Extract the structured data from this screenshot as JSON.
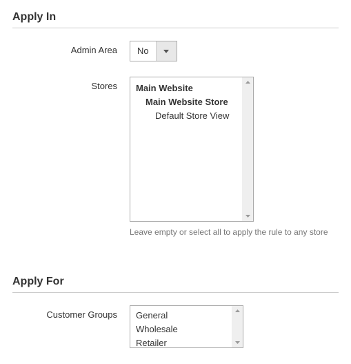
{
  "applyIn": {
    "title": "Apply In",
    "adminArea": {
      "label": "Admin Area",
      "value": "No"
    },
    "stores": {
      "label": "Stores",
      "items": [
        {
          "text": "Main Website",
          "bold": true,
          "indent": 0
        },
        {
          "text": "Main Website Store",
          "bold": true,
          "indent": 1
        },
        {
          "text": "Default Store View",
          "bold": false,
          "indent": 2
        }
      ],
      "note": "Leave empty or select all to apply the rule to any store"
    }
  },
  "applyFor": {
    "title": "Apply For",
    "customerGroups": {
      "label": "Customer Groups",
      "items": [
        {
          "text": "General"
        },
        {
          "text": "Wholesale"
        },
        {
          "text": "Retailer"
        }
      ]
    }
  }
}
